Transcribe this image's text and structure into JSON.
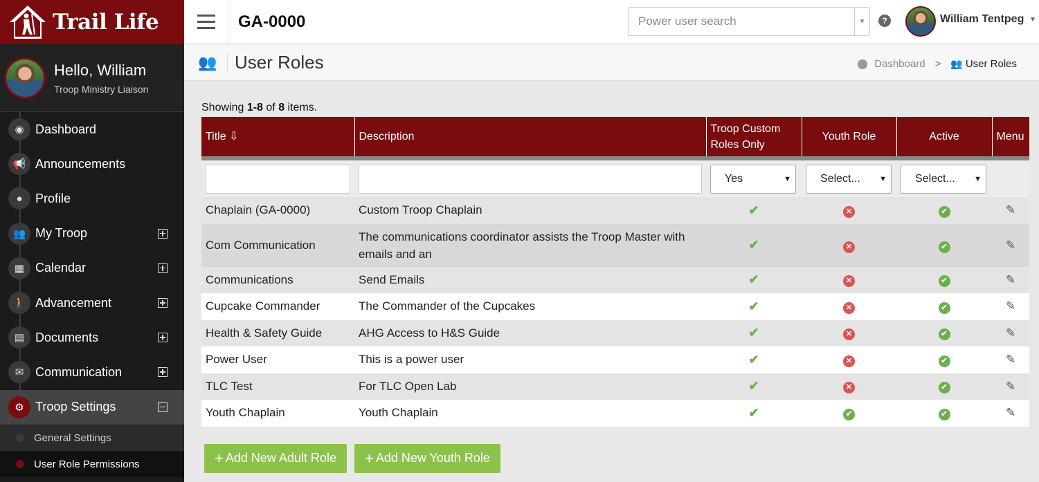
{
  "brand": {
    "name": "Trail Life"
  },
  "sidebar": {
    "greeting": "Hello, William",
    "role": "Troop Ministry Liaison",
    "items": [
      {
        "label": "Dashboard",
        "icon": "dashboard-icon",
        "glyph": "◉"
      },
      {
        "label": "Announcements",
        "icon": "megaphone-icon",
        "glyph": "📢"
      },
      {
        "label": "Profile",
        "icon": "user-icon",
        "glyph": "●"
      },
      {
        "label": "My Troop",
        "icon": "users-icon",
        "glyph": "👥"
      },
      {
        "label": "Calendar",
        "icon": "calendar-icon",
        "glyph": "▦"
      },
      {
        "label": "Advancement",
        "icon": "hiker-icon",
        "glyph": "🚶"
      },
      {
        "label": "Documents",
        "icon": "document-icon",
        "glyph": "▤"
      },
      {
        "label": "Communication",
        "icon": "envelope-icon",
        "glyph": "✉"
      },
      {
        "label": "Troop Settings",
        "icon": "gears-icon",
        "glyph": "⚙"
      }
    ],
    "subitems": [
      {
        "label": "General Settings"
      },
      {
        "label": "User Role Permissions"
      }
    ]
  },
  "topbar": {
    "unit_code": "GA-0000",
    "search_placeholder": "Power user search",
    "help_glyph": "?",
    "user_name": "William Tentpeg"
  },
  "page": {
    "title": "User Roles",
    "breadcrumb": {
      "home": "Dashboard",
      "current": "User Roles"
    }
  },
  "summary": {
    "prefix": "Showing ",
    "range": "1-8",
    "mid": " of ",
    "total": "8",
    "suffix": " items."
  },
  "table": {
    "headers": {
      "title": "Title",
      "description": "Description",
      "troop_custom": "Troop Custom Roles Only",
      "youth_role": "Youth Role",
      "active": "Active",
      "menu": "Menu"
    },
    "filters": {
      "troop_custom": "Yes",
      "youth_role": "Select...",
      "active": "Select..."
    },
    "rows": [
      {
        "title": "Chaplain (GA-0000)",
        "description": "Custom Troop Chaplain",
        "troop_custom": true,
        "youth": false,
        "active": true
      },
      {
        "title": "Com Communication",
        "description": "The communications coordinator assists the Troop Master with emails and an",
        "troop_custom": true,
        "youth": false,
        "active": true
      },
      {
        "title": "Communications",
        "description": "Send Emails",
        "troop_custom": true,
        "youth": false,
        "active": true
      },
      {
        "title": "Cupcake Commander",
        "description": "The Commander of the Cupcakes",
        "troop_custom": true,
        "youth": false,
        "active": true
      },
      {
        "title": "Health & Safety Guide",
        "description": "AHG Access to H&S Guide",
        "troop_custom": true,
        "youth": false,
        "active": true
      },
      {
        "title": "Power User",
        "description": "This is a power user",
        "troop_custom": true,
        "youth": false,
        "active": true
      },
      {
        "title": "TLC Test",
        "description": "For TLC Open Lab",
        "troop_custom": true,
        "youth": false,
        "active": true
      },
      {
        "title": "Youth Chaplain",
        "description": "Youth Chaplain",
        "troop_custom": true,
        "youth": true,
        "active": true
      }
    ]
  },
  "actions": {
    "add_adult": "Add New Adult Role",
    "add_youth": "Add New Youth Role"
  },
  "colors": {
    "brand": "#7a0c10",
    "success": "#6ab04c",
    "danger": "#e05252",
    "button": "#8bc34a"
  }
}
